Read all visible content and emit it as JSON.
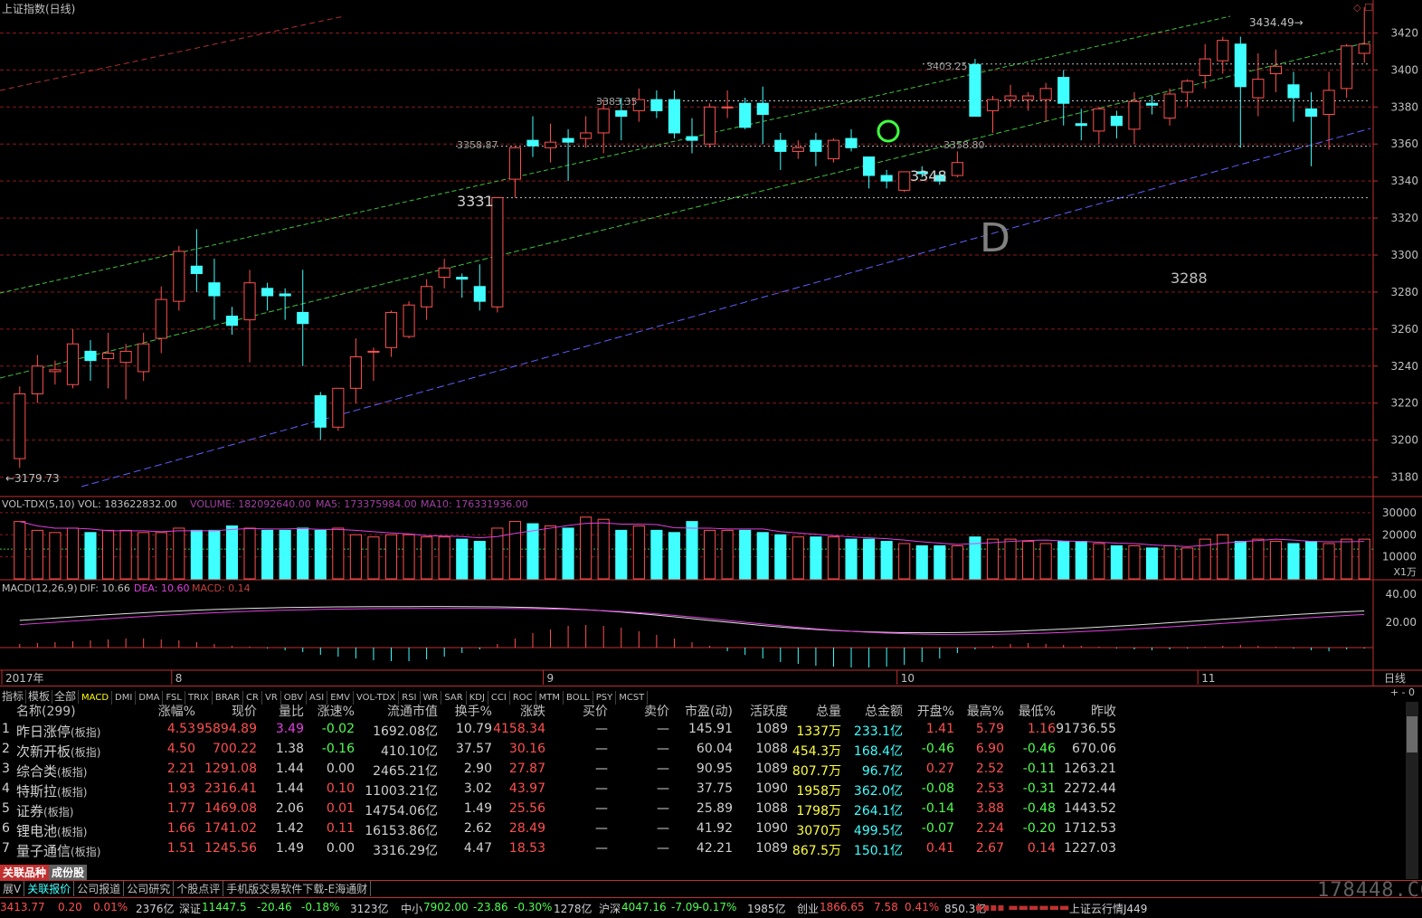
{
  "window": {
    "title": "上证指数(日线)"
  },
  "chart_data": [
    {
      "type": "candlestick",
      "title": "上证指数(日线)",
      "period": "日线",
      "ylim": [
        3170,
        3430
      ],
      "y_ticks": [
        3180,
        3200,
        3220,
        3240,
        3260,
        3280,
        3300,
        3320,
        3340,
        3360,
        3380,
        3400,
        3420
      ],
      "x_labels": [
        "2017年",
        "8",
        "9",
        "10",
        "11"
      ],
      "x_label_positions": [
        0,
        9,
        30,
        50,
        67
      ],
      "candles": [
        [
          3190,
          3229,
          3185,
          3225
        ],
        [
          3225,
          3246,
          3220,
          3240
        ],
        [
          3237,
          3243,
          3230,
          3238
        ],
        [
          3230,
          3260,
          3228,
          3252
        ],
        [
          3248,
          3254,
          3232,
          3243
        ],
        [
          3244,
          3258,
          3228,
          3247
        ],
        [
          3242,
          3252,
          3222,
          3248
        ],
        [
          3237,
          3258,
          3232,
          3252
        ],
        [
          3255,
          3283,
          3247,
          3276
        ],
        [
          3275,
          3305,
          3270,
          3302
        ],
        [
          3294,
          3314,
          3280,
          3290
        ],
        [
          3285,
          3298,
          3265,
          3278
        ],
        [
          3267,
          3272,
          3257,
          3262
        ],
        [
          3265,
          3292,
          3242,
          3285
        ],
        [
          3282,
          3285,
          3270,
          3278
        ],
        [
          3279,
          3282,
          3265,
          3278
        ],
        [
          3269,
          3292,
          3240,
          3263
        ],
        [
          3224,
          3226,
          3200,
          3207
        ],
        [
          3207,
          3222,
          3205,
          3228
        ],
        [
          3228,
          3255,
          3220,
          3245
        ],
        [
          3248,
          3250,
          3232,
          3248
        ],
        [
          3250,
          3270,
          3245,
          3269
        ],
        [
          3256,
          3275,
          3255,
          3273
        ],
        [
          3272,
          3287,
          3265,
          3283
        ],
        [
          3288,
          3298,
          3282,
          3293
        ],
        [
          3288,
          3290,
          3277,
          3287
        ],
        [
          3283,
          3295,
          3270,
          3275
        ],
        [
          3272,
          3299,
          3269,
          3331
        ],
        [
          3341,
          3359,
          3331,
          3358
        ],
        [
          3362,
          3375,
          3353,
          3359
        ],
        [
          3358,
          3371,
          3350,
          3361
        ],
        [
          3363,
          3368,
          3340,
          3361
        ],
        [
          3363,
          3375,
          3358,
          3366
        ],
        [
          3366,
          3384,
          3355,
          3379
        ],
        [
          3378,
          3385,
          3362,
          3375
        ],
        [
          3378,
          3390,
          3372,
          3384
        ],
        [
          3384,
          3389,
          3374,
          3378
        ],
        [
          3384,
          3389,
          3363,
          3366
        ],
        [
          3364,
          3374,
          3355,
          3362
        ],
        [
          3360,
          3382,
          3358,
          3380
        ],
        [
          3380,
          3389,
          3374,
          3380
        ],
        [
          3382,
          3385,
          3368,
          3369
        ],
        [
          3382,
          3391,
          3360,
          3376
        ],
        [
          3362,
          3366,
          3346,
          3356
        ],
        [
          3356,
          3362,
          3352,
          3358
        ],
        [
          3362,
          3366,
          3348,
          3356
        ],
        [
          3352,
          3363,
          3350,
          3362
        ],
        [
          3363,
          3368,
          3356,
          3358
        ],
        [
          3353,
          3345,
          3336,
          3343
        ],
        [
          3343,
          3346,
          3336,
          3340
        ],
        [
          3335,
          3342,
          3334,
          3345
        ],
        [
          3345,
          3348,
          3342,
          3344
        ],
        [
          3343,
          3345,
          3338,
          3340
        ],
        [
          3343,
          3356,
          3342,
          3350
        ],
        [
          3403,
          3406,
          3378,
          3375
        ],
        [
          3378,
          3386,
          3366,
          3384
        ],
        [
          3384,
          3392,
          3380,
          3386
        ],
        [
          3384,
          3388,
          3378,
          3386
        ],
        [
          3384,
          3393,
          3372,
          3390
        ],
        [
          3396,
          3400,
          3370,
          3382
        ],
        [
          3371,
          3379,
          3362,
          3370
        ],
        [
          3367,
          3380,
          3360,
          3379
        ],
        [
          3375,
          3378,
          3363,
          3370
        ],
        [
          3368,
          3388,
          3360,
          3383
        ],
        [
          3382,
          3386,
          3376,
          3381
        ],
        [
          3374,
          3390,
          3370,
          3387
        ],
        [
          3388,
          3395,
          3380,
          3394
        ],
        [
          3397,
          3414,
          3390,
          3406
        ],
        [
          3405,
          3418,
          3398,
          3416
        ],
        [
          3414,
          3418,
          3358,
          3391
        ],
        [
          3385,
          3409,
          3375,
          3395
        ],
        [
          3398,
          3411,
          3388,
          3402
        ],
        [
          3392,
          3399,
          3372,
          3385
        ],
        [
          3379,
          3388,
          3348,
          3375
        ],
        [
          3376,
          3399,
          3357,
          3389
        ],
        [
          3390,
          3414,
          3385,
          3413
        ],
        [
          3409,
          3434,
          3404,
          3414
        ]
      ],
      "annotations": [
        "3179.73",
        "3331",
        "3358.87",
        "3383.35",
        "3403.25",
        "3358.80",
        "3348",
        "3434.49",
        "3288",
        "D"
      ]
    },
    {
      "type": "bar",
      "title": "VOL-TDX(5,10)",
      "legend": {
        "VOL": "VOL: 183622832.00",
        "VOLUME": "VOLUME: 182092640.00",
        "MA5": "MA5: 173375984.00",
        "MA10": "MA10: 176331936.00"
      },
      "y_ticks": [
        10000,
        20000,
        30000
      ],
      "ylim": [
        0,
        32000
      ],
      "unit": "X1万",
      "values": [
        26000,
        22000,
        21000,
        23000,
        21000,
        22000,
        22000,
        21000,
        21000,
        23000,
        22000,
        22000,
        24000,
        23000,
        22000,
        22000,
        23000,
        22000,
        23000,
        20000,
        19000,
        20000,
        20000,
        19000,
        19000,
        18000,
        17000,
        23000,
        26000,
        25000,
        24000,
        23000,
        28000,
        27000,
        22000,
        24000,
        22000,
        21000,
        26000,
        22000,
        22000,
        22000,
        21000,
        20000,
        19000,
        19000,
        19000,
        18000,
        18000,
        17000,
        16000,
        15000,
        15000,
        15000,
        19000,
        18000,
        18000,
        17000,
        16000,
        17000,
        17000,
        16000,
        15000,
        15000,
        14000,
        15000,
        14000,
        18000,
        20000,
        17000,
        18000,
        17000,
        16000,
        17000,
        16000,
        18000,
        18000
      ]
    },
    {
      "type": "line",
      "title": "MACD(12,26,9)",
      "legend": {
        "DIF": "DIF: 10.66",
        "DEA": "DEA: 10.60",
        "MACD": "MACD: 0.14"
      },
      "y_ticks": [
        20.0,
        40.0
      ]
    }
  ],
  "indicator_tabs": [
    "指标",
    "模板",
    "全部",
    "MACD",
    "DMI",
    "DMA",
    "FSL",
    "TRIX",
    "BRAR",
    "CR",
    "VR",
    "OBV",
    "ASI",
    "EMV",
    "VOL-TDX",
    "RSI",
    "WR",
    "SAR",
    "KDJ",
    "CCI",
    "ROC",
    "MTM",
    "BOLL",
    "PSY",
    "MCST"
  ],
  "period_label": "日线",
  "table": {
    "headers": [
      "名称(299)",
      "涨幅%",
      "现价",
      "量比",
      "涨速%",
      "流通市值",
      "换手%",
      "涨跌",
      "买价",
      "卖价",
      "市盈(动)",
      "活跃度",
      "总量",
      "总金额",
      "开盘%",
      "最高%",
      "最低%",
      "昨收"
    ],
    "rows": [
      {
        "idx": "1",
        "name": "昨日涨停",
        "tag": "(板指)",
        "chg": "4.53",
        "price": "95894.89",
        "vr": "3.49",
        "spd": "-0.02",
        "mcap": "1692.08亿",
        "turn": "10.79",
        "delta": "4158.34",
        "bid": "—",
        "ask": "—",
        "pe": "145.91",
        "act": "1089",
        "vol": "1337万",
        "amt": "233.1亿",
        "open": "1.41",
        "high": "5.79",
        "low": "1.16",
        "prev": "91736.55"
      },
      {
        "idx": "2",
        "name": "次新开板",
        "tag": "(板指)",
        "chg": "4.50",
        "price": "700.22",
        "vr": "1.38",
        "spd": "-0.16",
        "mcap": "410.10亿",
        "turn": "37.57",
        "delta": "30.16",
        "bid": "—",
        "ask": "—",
        "pe": "60.04",
        "act": "1088",
        "vol": "454.3万",
        "amt": "168.4亿",
        "open": "-0.46",
        "high": "6.90",
        "low": "-0.46",
        "prev": "670.06"
      },
      {
        "idx": "3",
        "name": "综合类",
        "tag": "(板指)",
        "chg": "2.21",
        "price": "1291.08",
        "vr": "1.44",
        "spd": "0.00",
        "mcap": "2465.21亿",
        "turn": "2.90",
        "delta": "27.87",
        "bid": "—",
        "ask": "—",
        "pe": "90.95",
        "act": "1089",
        "vol": "807.7万",
        "amt": "96.7亿",
        "open": "0.27",
        "high": "2.52",
        "low": "-0.11",
        "prev": "1263.21"
      },
      {
        "idx": "4",
        "name": "特斯拉",
        "tag": "(板指)",
        "chg": "1.93",
        "price": "2316.41",
        "vr": "1.44",
        "spd": "0.10",
        "mcap": "11003.21亿",
        "turn": "3.02",
        "delta": "43.97",
        "bid": "—",
        "ask": "—",
        "pe": "37.75",
        "act": "1090",
        "vol": "1958万",
        "amt": "362.0亿",
        "open": "-0.08",
        "high": "2.53",
        "low": "-0.31",
        "prev": "2272.44"
      },
      {
        "idx": "5",
        "name": "证券",
        "tag": "(板指)",
        "chg": "1.77",
        "price": "1469.08",
        "vr": "2.06",
        "spd": "0.01",
        "mcap": "14754.06亿",
        "turn": "1.49",
        "delta": "25.56",
        "bid": "—",
        "ask": "—",
        "pe": "25.89",
        "act": "1088",
        "vol": "1798万",
        "amt": "264.1亿",
        "open": "-0.14",
        "high": "3.88",
        "low": "-0.48",
        "prev": "1443.52"
      },
      {
        "idx": "6",
        "name": "锂电池",
        "tag": "(板指)",
        "chg": "1.66",
        "price": "1741.02",
        "vr": "1.42",
        "spd": "0.11",
        "mcap": "16153.86亿",
        "turn": "2.62",
        "delta": "28.49",
        "bid": "—",
        "ask": "—",
        "pe": "41.92",
        "act": "1090",
        "vol": "3070万",
        "amt": "499.5亿",
        "open": "-0.07",
        "high": "2.24",
        "low": "-0.20",
        "prev": "1712.53"
      },
      {
        "idx": "7",
        "name": "量子通信",
        "tag": "(板指)",
        "chg": "1.51",
        "price": "1245.56",
        "vr": "1.49",
        "spd": "0.00",
        "mcap": "3316.29亿",
        "turn": "4.47",
        "delta": "18.53",
        "bid": "—",
        "ask": "—",
        "pe": "42.21",
        "act": "1089",
        "vol": "867.5万",
        "amt": "150.1亿",
        "open": "0.41",
        "high": "2.67",
        "low": "0.14",
        "prev": "1227.03"
      }
    ]
  },
  "bottom_tabs": [
    "关联品种",
    "成份股"
  ],
  "sub_tabs": [
    "展V",
    "关联报价",
    "公司报道",
    "公司研究",
    "个股点评",
    "手机版交易软件下载-E海通财"
  ],
  "status_bar": {
    "sh": {
      "val": "3413.77",
      "chg": "0.20",
      "pct": "0.01%",
      "amt": "2376亿"
    },
    "sz": {
      "label": "深证",
      "val": "11447.5",
      "chg": "-20.46",
      "pct": "-0.18%",
      "amt": "3123亿"
    },
    "zx": {
      "label": "中小",
      "val": "7902.00",
      "chg": "-23.86",
      "pct": "-0.30%",
      "amt": "1278亿"
    },
    "hs": {
      "label": "沪深",
      "val": "4047.16",
      "chg": "-7.09",
      "pct": "-0.17%",
      "amt": "1985亿"
    },
    "cy": {
      "label": "创业",
      "val": "1866.65",
      "chg": "7.58",
      "pct": "0.41%",
      "amt": "850.3亿"
    },
    "cloud": "上证云行情J449"
  },
  "watermark": "178448.COM",
  "colors": {
    "up": "#ff5050",
    "down": "#40ffff",
    "bg": "#000000",
    "grid": "#8b1a1a"
  }
}
